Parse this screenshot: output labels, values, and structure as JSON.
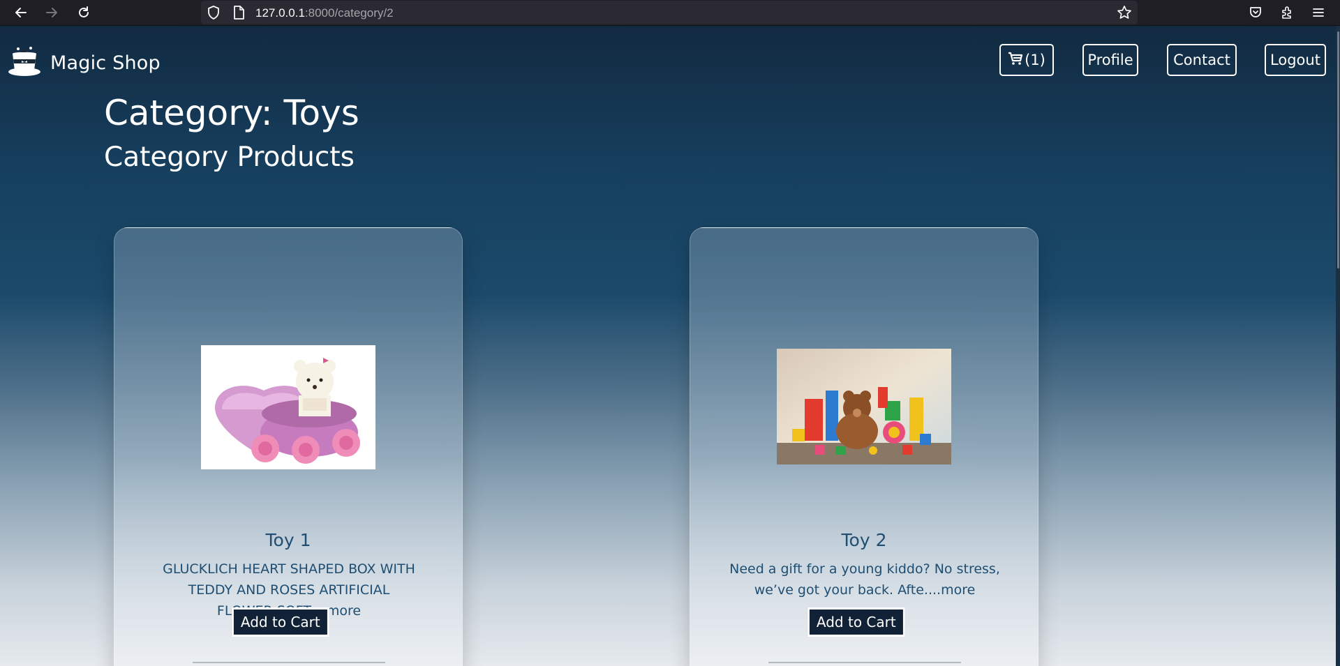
{
  "browser": {
    "url_host": "127.0.0.1",
    "url_path": ":8000/category/2"
  },
  "header": {
    "brand": "Magic Shop",
    "cart_label": "(1)",
    "profile_label": "Profile",
    "contact_label": "Contact",
    "logout_label": "Logout"
  },
  "page": {
    "title": "Category: Toys",
    "subtitle": "Category Products"
  },
  "products": [
    {
      "name": "Toy 1",
      "description": "GLUCKLICH HEART SHAPED BOX WITH TEDDY AND ROSES ARTIFICIAL FLOWER,SOFT....more",
      "button": "Add to Cart"
    },
    {
      "name": "Toy 2",
      "description": "Need a gift for a young kiddo? No stress, we’ve got your back. Afte....more",
      "button": "Add to Cart"
    }
  ],
  "colors": {
    "accent_text": "#1f4e72",
    "button_bg": "#122236"
  }
}
